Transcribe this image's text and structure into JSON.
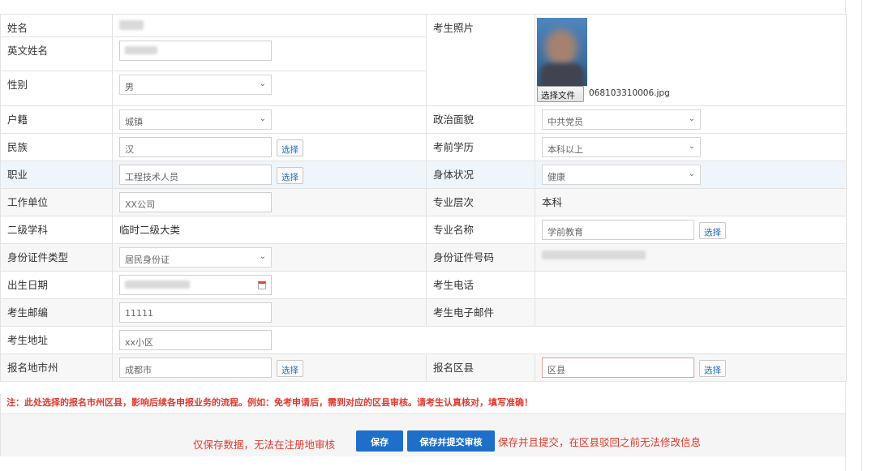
{
  "fields": {
    "name_label": "姓名",
    "photo_label": "考生照片",
    "english_name_label": "英文姓名",
    "gender_label": "性别",
    "gender_value": "男",
    "hukou_label": "户籍",
    "hukou_value": "城镇",
    "political_label": "政治面貌",
    "political_value": "中共党员",
    "ethnic_label": "民族",
    "ethnic_value": "汉",
    "education_label": "考前学历",
    "education_value": "本科以上",
    "occupation_label": "职业",
    "occupation_value": "工程技术人员",
    "health_label": "身体状况",
    "health_value": "健康",
    "employer_label": "工作单位",
    "employer_value": "XX公司",
    "major_level_label": "专业层次",
    "major_level_value": "本科",
    "subject_label": "二级学科",
    "subject_value": "临时二级大类",
    "major_name_label": "专业名称",
    "major_name_value": "学前教育",
    "id_type_label": "身份证件类型",
    "id_type_value": "居民身份证",
    "id_number_label": "身份证件号码",
    "birth_label": "出生日期",
    "phone_label": "考生电话",
    "postcode_label": "考生邮编",
    "postcode_value": "11111",
    "email_label": "考生电子邮件",
    "address_label": "考生地址",
    "address_value": "xx小区",
    "city_label": "报名地市州",
    "city_value": "成都市",
    "district_label": "报名区县",
    "district_placeholder": "区县"
  },
  "pick_button_label": "选择",
  "file": {
    "button_label": "选择文件",
    "file_name": "068103310006.jpg"
  },
  "note": "注：此处选择的报名市州区县，影响后续各申报业务的流程。例如：免考申请后，需到对应的区县审核。请考生认真核对，填写准确！",
  "actions": {
    "save_hint": "仅保存数据，无法在注册地审核",
    "save_label": "保存",
    "submit_label": "保存并提交审核",
    "submit_hint": "保存并且提交，在区县驳回之前无法修改信息"
  },
  "colors": {
    "accent": "#1e6fc9",
    "warning": "#e03a2f",
    "link": "#1e6fb5"
  }
}
